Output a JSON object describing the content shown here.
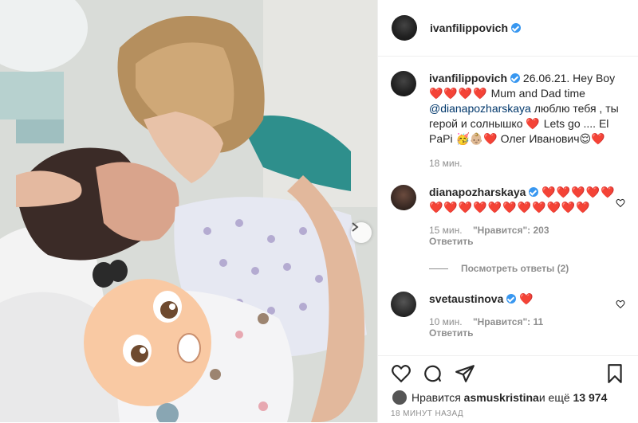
{
  "post": {
    "author": "ivanfilippovich",
    "caption": {
      "author": "ivanfilippovich",
      "line1": "26.06.21. Hey Boy",
      "line2_hearts": "❤️❤️❤️❤️",
      "line2_text": " Mum and Dad time",
      "mention": "@dianapozharskaya",
      "line3_text": " люблю тебя , ты герой и солнышко ",
      "heart": "❤️",
      "line4_text": " Lets go .... El PaPi ",
      "emojis": "🥳👶🏼❤️",
      "line5_text": " Олег Иванович",
      "end_emojis": "😌❤️",
      "time": "18 мин."
    },
    "comments": [
      {
        "user": "dianapozharskaya",
        "text": "❤️❤️❤️❤️❤️❤️❤️❤️❤️❤️❤️❤️❤️❤️❤️❤️",
        "time": "15 мин.",
        "likes": "\"Нравится\": 203",
        "reply": "Ответить"
      },
      {
        "user": "svetaustinova",
        "text": "❤️",
        "time": "10 мин.",
        "likes": "\"Нравится\": 11",
        "reply": "Ответить"
      }
    ],
    "view_replies": "Посмотреть ответы (2)",
    "liked_by_prefix": "Нравится ",
    "liked_by_user": "asmuskristina",
    "liked_by_suffix": " и ещё ",
    "liked_by_count": "13 974",
    "timestamp": "18 МИНУТ НАЗАД"
  },
  "colors": {
    "verified": "#3897f0",
    "heart": "#ed2f3f",
    "muted": "#8e8e8e",
    "link": "#00376b"
  },
  "icons": [
    "heart-icon",
    "comment-icon",
    "share-icon",
    "bookmark-icon",
    "chevron-right-icon",
    "verified-icon"
  ]
}
